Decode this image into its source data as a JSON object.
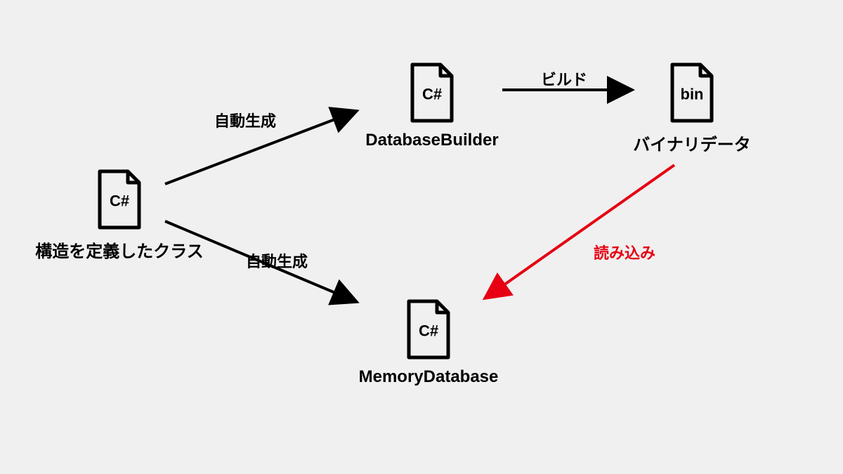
{
  "nodes": {
    "source": {
      "filetype": "C#",
      "caption": "構造を定義したクラス"
    },
    "builder": {
      "filetype": "C#",
      "caption": "DatabaseBuilder"
    },
    "binary": {
      "filetype": "bin",
      "caption": "バイナリデータ"
    },
    "memorydb": {
      "filetype": "C#",
      "caption": "MemoryDatabase"
    }
  },
  "edges": {
    "autogen1": "自動生成",
    "autogen2": "自動生成",
    "build": "ビルド",
    "load": "読み込み"
  }
}
